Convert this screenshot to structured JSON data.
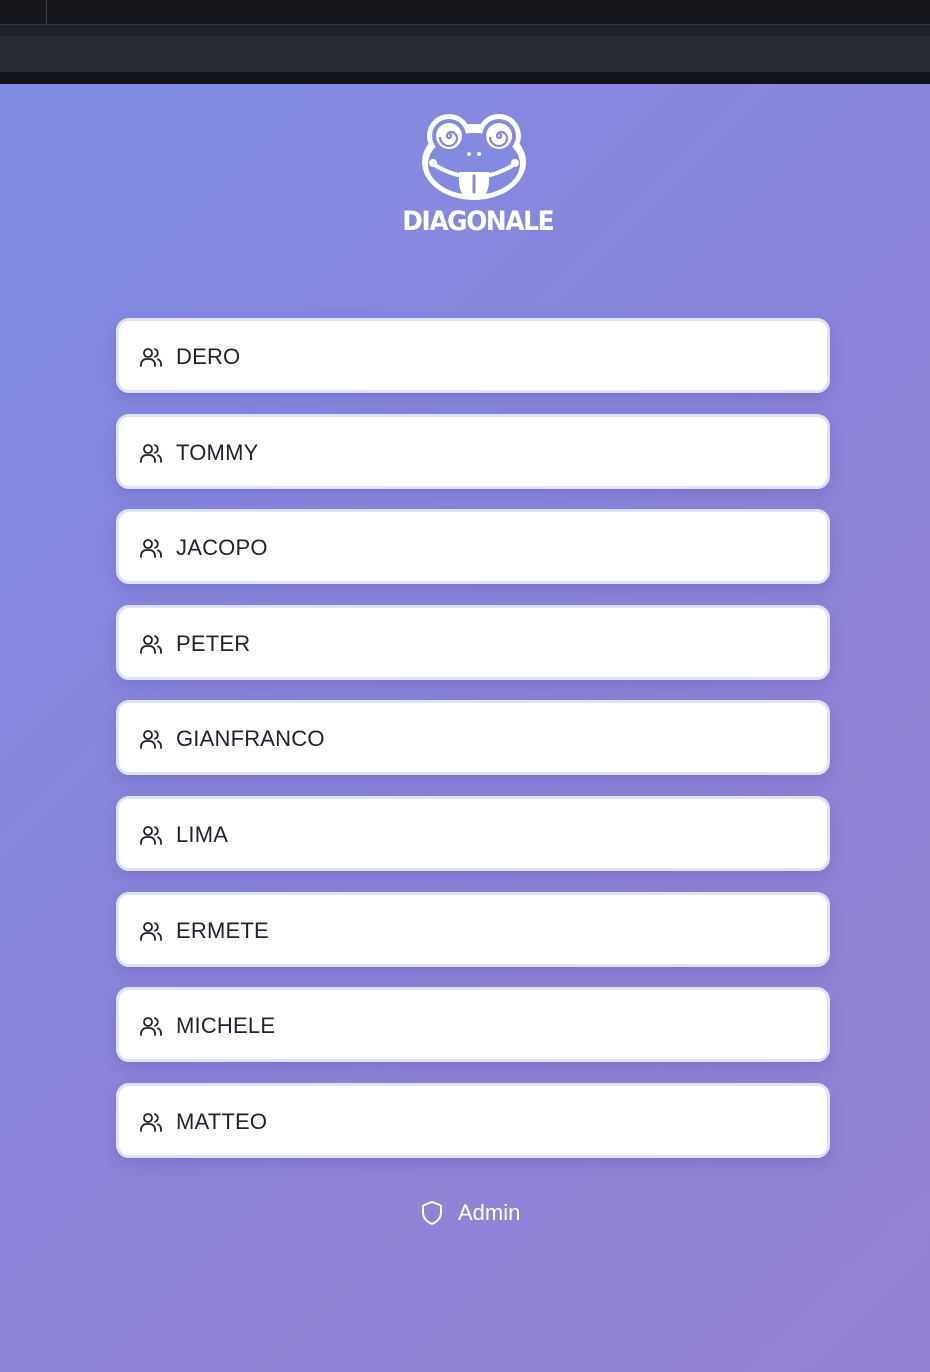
{
  "brand": {
    "name": "DIAGONALE",
    "logo_icon": "frog-face-logo"
  },
  "users": [
    {
      "label": "DERO",
      "icon": "users-icon"
    },
    {
      "label": "TOMMY",
      "icon": "users-icon"
    },
    {
      "label": "JACOPO",
      "icon": "users-icon"
    },
    {
      "label": "PETER",
      "icon": "users-icon"
    },
    {
      "label": "GIANFRANCO",
      "icon": "users-icon"
    },
    {
      "label": "LIMA",
      "icon": "users-icon"
    },
    {
      "label": "ERMETE",
      "icon": "users-icon"
    },
    {
      "label": "MICHELE",
      "icon": "users-icon"
    },
    {
      "label": "MATTEO",
      "icon": "users-icon"
    }
  ],
  "admin": {
    "label": "Admin",
    "icon": "shield-icon"
  },
  "colors": {
    "background_start": "#7f8ce2",
    "background_end": "#9581d1",
    "card": "#ffffff",
    "card_border": "#dfe2f8",
    "text_dark": "#1f2230"
  }
}
